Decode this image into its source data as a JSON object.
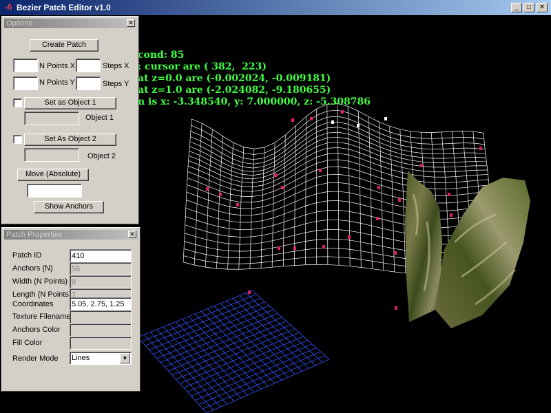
{
  "window": {
    "title": "Bezier Patch Editor v1.0",
    "icon_glyph": "-ñ",
    "controls": {
      "minimize": "_",
      "maximize": "□",
      "close": "✕"
    }
  },
  "readout": {
    "lines": [
      "cond: 85",
      ": cursor are ( 382,  223)",
      "at z=0.0 are (-0.002024, -0.009181)",
      "at z=1.0 are (-2.024082, -9.180655)",
      "n is x: -3.348540, y: 7.000000, z: -5.308786"
    ]
  },
  "options_panel": {
    "title": "Options",
    "close_glyph": "✕",
    "create_patch": "Create Patch",
    "n_points_x_label": "N Points X",
    "steps_x_label": "Steps X",
    "n_points_y_label": "N Points Y",
    "steps_y_label": "Steps Y",
    "n_points_x": "",
    "steps_x": "",
    "n_points_y": "",
    "steps_y": "",
    "set_object_1": "Set as Object 1",
    "object_1_label": "Object 1",
    "object_1_value": "",
    "set_object_2": "Set As Object 2",
    "object_2_label": "Object 2",
    "object_2_value": "",
    "move": "Move (Absolute)",
    "move_value": "",
    "show_anchors": "Show Anchors"
  },
  "properties_panel": {
    "title": "Patch Properties",
    "close_glyph": "✕",
    "patch_id_label": "Patch ID",
    "patch_id": "410",
    "anchors_label": "Anchors (N)",
    "anchors": "56",
    "width_label": "Width (N Points)",
    "width": "8",
    "length_label": "Length (N Points)",
    "length": "7",
    "coordinates_label": "Coordinates",
    "coordinates": "5.05, 2.75, 1.25",
    "texture_label": "Texture Filename",
    "texture": "",
    "anchors_color_label": "Anchors Color",
    "fill_color_label": "Fill Color",
    "render_mode_label": "Render Mode",
    "render_mode": "Lines",
    "dropdown_glyph": "▼"
  },
  "colors": {
    "readout_text": "#3fff3f",
    "wireframe": "#ffffff",
    "grid": "#3355ff",
    "anchor": "#e0206a"
  }
}
